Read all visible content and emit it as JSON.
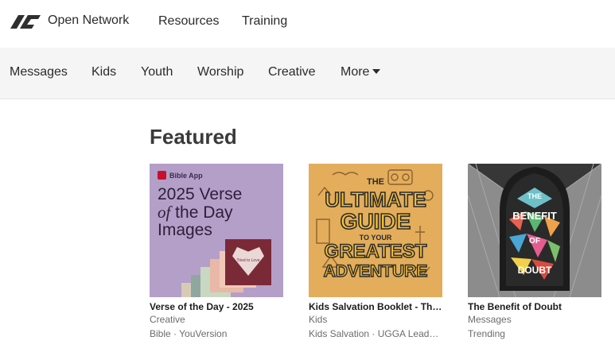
{
  "header": {
    "brand_name": "Open Network",
    "nav": [
      "Resources",
      "Training"
    ]
  },
  "categories": {
    "items": [
      "Messages",
      "Kids",
      "Youth",
      "Worship",
      "Creative"
    ],
    "more_label": "More"
  },
  "featured": {
    "title": "Featured",
    "cards": [
      {
        "title": "Verse of the Day - 2025",
        "category": "Creative",
        "meta": "Bible · YouVersion",
        "art": {
          "app_label": "Bible App",
          "line1": "2025 Verse",
          "line2_em": "of",
          "line2_rest": " the Day",
          "line3": "Images",
          "card_text": "Tried to Love"
        }
      },
      {
        "title": "Kids Salvation Booklet - The Ultimate Guide to Your Greatest Adventure",
        "category": "Kids",
        "meta": "Kids Salvation · UGGA Leader Guide",
        "art": {
          "line1": "THE",
          "line2": "ULTIMATE",
          "line3": "GUIDE",
          "line4": "TO YOUR",
          "line5": "GREATEST",
          "line6": "ADVENTURE"
        }
      },
      {
        "title": "The Benefit of Doubt",
        "category": "Messages",
        "meta": "Trending",
        "art": {
          "line1": "THE",
          "line2": "BENEFIT",
          "line3": "OF",
          "line4": "DOUBT"
        }
      }
    ]
  },
  "colors": {
    "card1_bg": "#b49fc8",
    "card2_bg": "#e3ad5c",
    "card3_bg": "#9a9a9a",
    "category_bar_bg": "#f5f5f5"
  }
}
